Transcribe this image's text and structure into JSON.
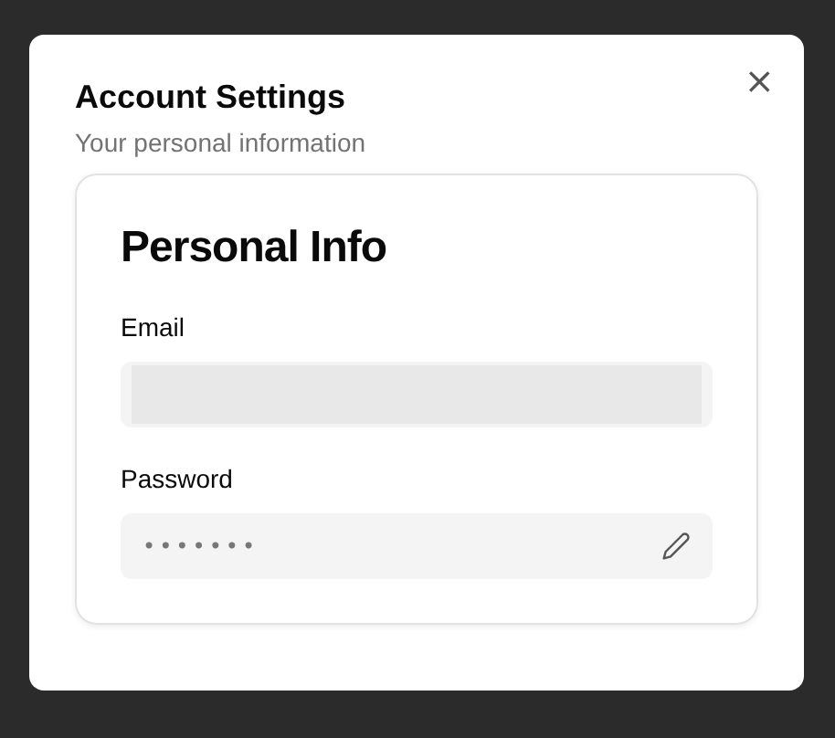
{
  "dialog": {
    "title": "Account Settings",
    "subtitle": "Your personal information",
    "close": "×"
  },
  "card": {
    "title": "Personal Info",
    "fields": [
      {
        "label": "Email",
        "kind": "loading"
      },
      {
        "label": "Password",
        "kind": "password",
        "value": "•••••••"
      }
    ]
  }
}
